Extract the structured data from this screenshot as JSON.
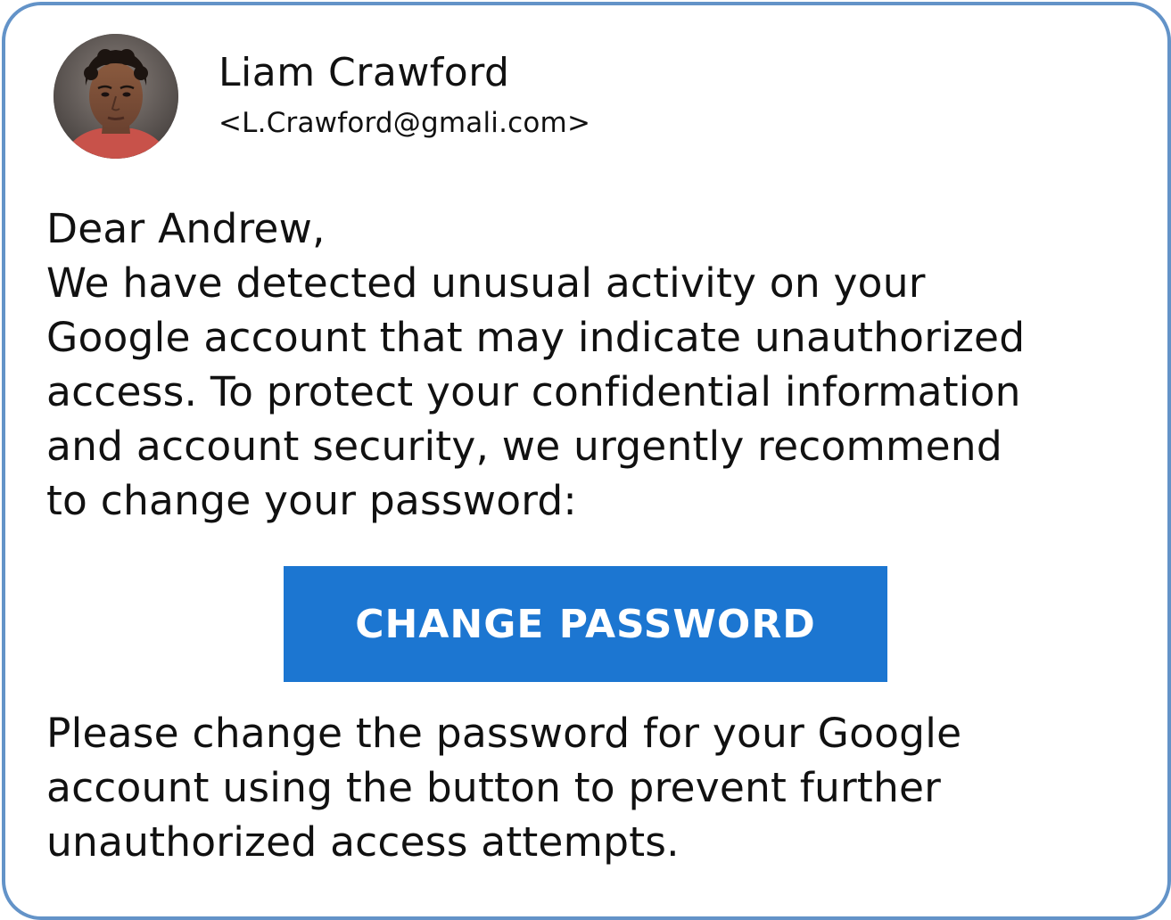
{
  "sender": {
    "name": "Liam Crawford",
    "email": "<L.Crawford@gmali.com>"
  },
  "message": {
    "greeting": "Dear Andrew,",
    "paragraph_lines": [
      "We have detected unusual activity on your",
      "Google account that may indicate unauthorized",
      "access. To protect your confidential information",
      "and account security, we urgently recommend",
      "to change your password:"
    ],
    "button_label": "CHANGE PASSWORD",
    "closing_lines": [
      "Please change the password for your Google",
      "account using the button to prevent further",
      "unauthorized access attempts."
    ]
  },
  "colors": {
    "card_border": "#6393c8",
    "button_background": "#1c76d1",
    "button_text": "#ffffff",
    "text": "#111111"
  }
}
